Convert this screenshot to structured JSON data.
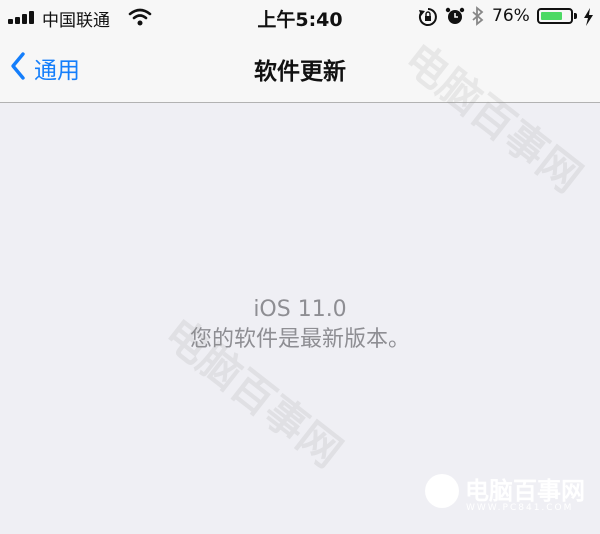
{
  "status_bar": {
    "carrier": "中国联通",
    "time": "上午5:40",
    "battery_percent": "76%",
    "battery_level": 0.76,
    "colors": {
      "battery_fill": "#4cd964"
    },
    "icons": [
      "signal-icon",
      "wifi-icon",
      "rotation-lock-icon",
      "alarm-icon",
      "bluetooth-icon",
      "battery-icon",
      "charging-icon"
    ]
  },
  "nav": {
    "back_label": "通用",
    "title": "软件更新",
    "colors": {
      "accent": "#147efb"
    }
  },
  "content": {
    "os_version": "iOS 11.0",
    "status_message": "您的软件是最新版本。"
  },
  "watermark": {
    "text": "电脑百事网",
    "url": "WWW.PC841.COM"
  }
}
